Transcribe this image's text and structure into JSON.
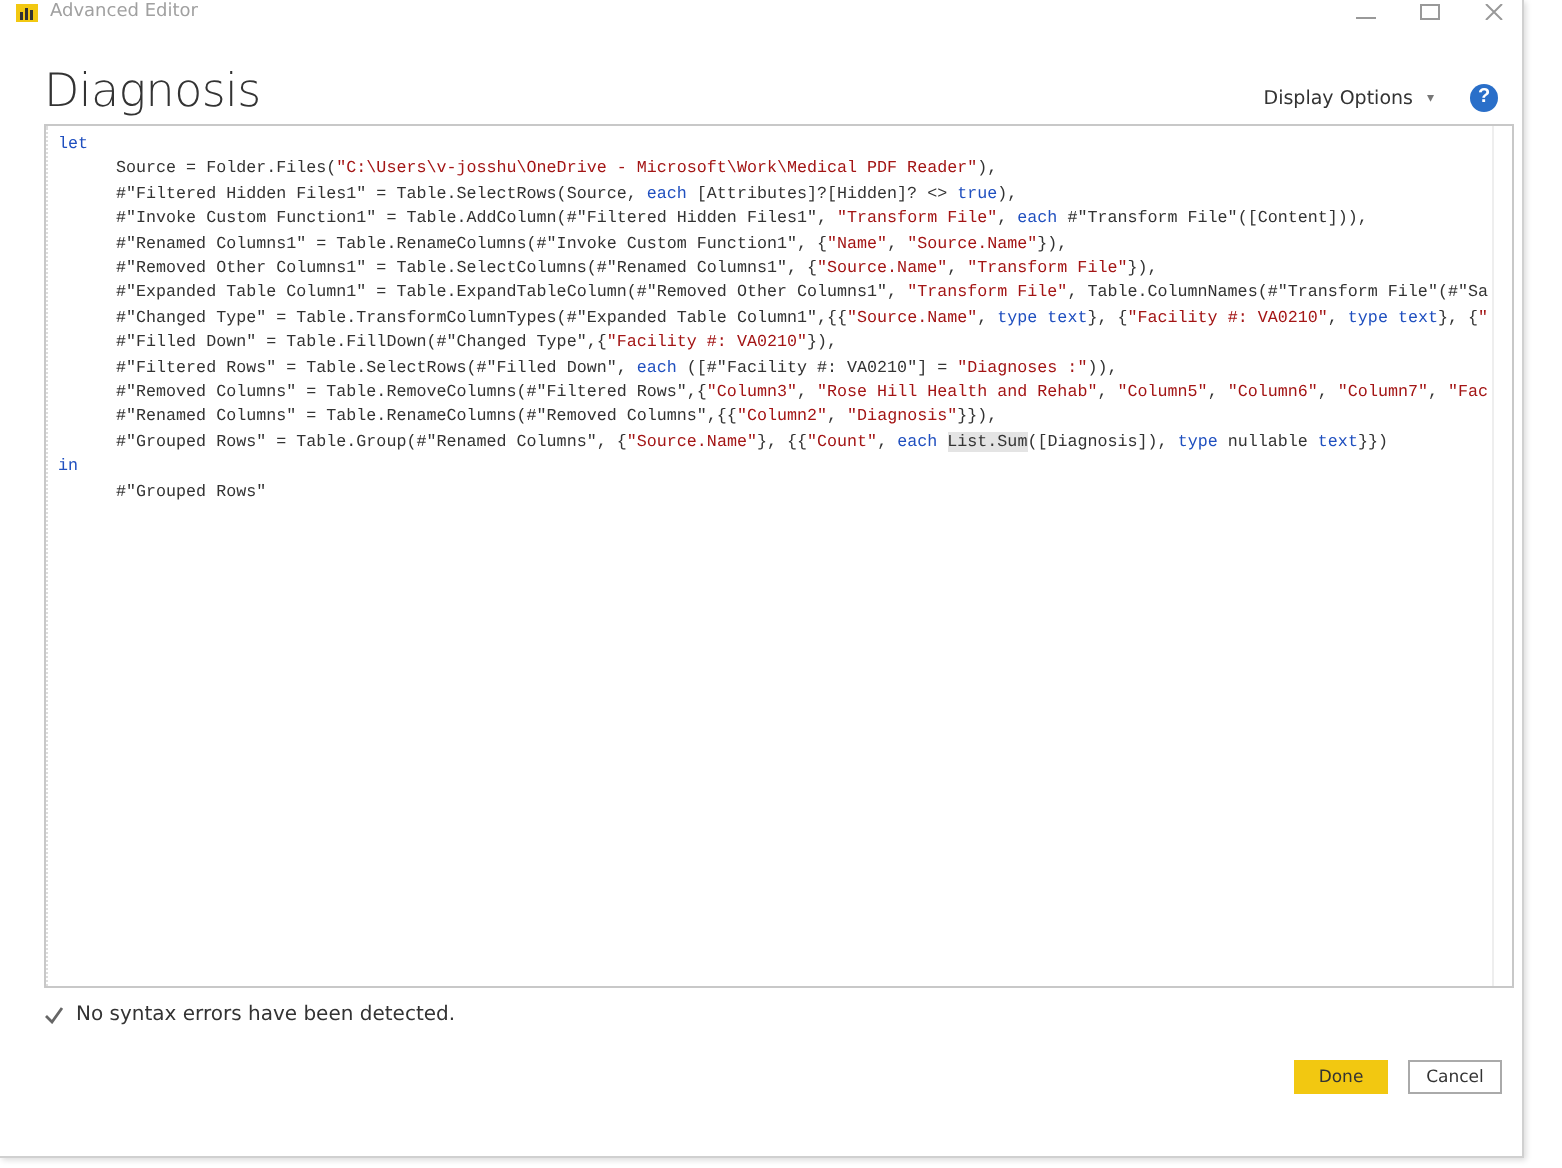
{
  "window": {
    "title": "Advanced Editor"
  },
  "heading": "Diagnosis",
  "display_options": {
    "label": "Display Options",
    "caret": "▾"
  },
  "help": {
    "label": "?"
  },
  "code": [
    {
      "keyword": "let",
      "children": [
        {
          "tokens": [
            {
              "kind": "plain",
              "text": "Source = Folder.Files("
            },
            {
              "kind": "string",
              "text": "\"C:\\Users\\v-josshu\\OneDrive - Microsoft\\Work\\Medical PDF Reader\""
            },
            {
              "kind": "plain",
              "text": "),"
            }
          ]
        },
        {
          "tokens": [
            {
              "kind": "plain",
              "text": "#\"Filtered Hidden Files1\" = Table.SelectRows(Source, "
            },
            {
              "kind": "keyword",
              "text": "each"
            },
            {
              "kind": "plain",
              "text": " [Attributes]?[Hidden]? <> "
            },
            {
              "kind": "keyword",
              "text": "true"
            },
            {
              "kind": "plain",
              "text": "),"
            }
          ]
        },
        {
          "tokens": [
            {
              "kind": "plain",
              "text": "#\"Invoke Custom Function1\" = Table.AddColumn(#\"Filtered Hidden Files1\", "
            },
            {
              "kind": "string",
              "text": "\"Transform File\""
            },
            {
              "kind": "plain",
              "text": ", "
            },
            {
              "kind": "keyword",
              "text": "each"
            },
            {
              "kind": "plain",
              "text": " #\"Transform File\"([Content])),"
            }
          ]
        },
        {
          "tokens": [
            {
              "kind": "plain",
              "text": "#\"Renamed Columns1\" = Table.RenameColumns(#\"Invoke Custom Function1\", {"
            },
            {
              "kind": "string",
              "text": "\"Name\""
            },
            {
              "kind": "plain",
              "text": ", "
            },
            {
              "kind": "string",
              "text": "\"Source.Name\""
            },
            {
              "kind": "plain",
              "text": "}),"
            }
          ]
        },
        {
          "tokens": [
            {
              "kind": "plain",
              "text": "#\"Removed Other Columns1\" = Table.SelectColumns(#\"Renamed Columns1\", {"
            },
            {
              "kind": "string",
              "text": "\"Source.Name\""
            },
            {
              "kind": "plain",
              "text": ", "
            },
            {
              "kind": "string",
              "text": "\"Transform File\""
            },
            {
              "kind": "plain",
              "text": "}),"
            }
          ]
        },
        {
          "tokens": [
            {
              "kind": "plain",
              "text": "#\"Expanded Table Column1\" = Table.ExpandTableColumn(#\"Removed Other Columns1\", "
            },
            {
              "kind": "string",
              "text": "\"Transform File\""
            },
            {
              "kind": "plain",
              "text": ", Table.ColumnNames(#\"Transform File\"(#\"Sa"
            }
          ]
        },
        {
          "tokens": [
            {
              "kind": "plain",
              "text": "#\"Changed Type\" = Table.TransformColumnTypes(#\"Expanded Table Column1\",{{"
            },
            {
              "kind": "string",
              "text": "\"Source.Name\""
            },
            {
              "kind": "plain",
              "text": ", "
            },
            {
              "kind": "keyword",
              "text": "type text"
            },
            {
              "kind": "plain",
              "text": "}, {"
            },
            {
              "kind": "string",
              "text": "\"Facility #: VA0210\""
            },
            {
              "kind": "plain",
              "text": ", "
            },
            {
              "kind": "keyword",
              "text": "type text"
            },
            {
              "kind": "plain",
              "text": "}, {"
            },
            {
              "kind": "string",
              "text": "\""
            }
          ]
        },
        {
          "tokens": [
            {
              "kind": "plain",
              "text": "#\"Filled Down\" = Table.FillDown(#\"Changed Type\",{"
            },
            {
              "kind": "string",
              "text": "\"Facility #: VA0210\""
            },
            {
              "kind": "plain",
              "text": "}),"
            }
          ]
        },
        {
          "tokens": [
            {
              "kind": "plain",
              "text": "#\"Filtered Rows\" = Table.SelectRows(#\"Filled Down\", "
            },
            {
              "kind": "keyword",
              "text": "each"
            },
            {
              "kind": "plain",
              "text": " ([#\"Facility #: VA0210\"] = "
            },
            {
              "kind": "string",
              "text": "\"Diagnoses :\""
            },
            {
              "kind": "plain",
              "text": ")),"
            }
          ]
        },
        {
          "tokens": [
            {
              "kind": "plain",
              "text": "#\"Removed Columns\" = Table.RemoveColumns(#\"Filtered Rows\",{"
            },
            {
              "kind": "string",
              "text": "\"Column3\""
            },
            {
              "kind": "plain",
              "text": ", "
            },
            {
              "kind": "string",
              "text": "\"Rose Hill Health and Rehab\""
            },
            {
              "kind": "plain",
              "text": ", "
            },
            {
              "kind": "string",
              "text": "\"Column5\""
            },
            {
              "kind": "plain",
              "text": ", "
            },
            {
              "kind": "string",
              "text": "\"Column6\""
            },
            {
              "kind": "plain",
              "text": ", "
            },
            {
              "kind": "string",
              "text": "\"Column7\""
            },
            {
              "kind": "plain",
              "text": ", "
            },
            {
              "kind": "string",
              "text": "\"Fac"
            }
          ]
        },
        {
          "tokens": [
            {
              "kind": "plain",
              "text": "#\"Renamed Columns\" = Table.RenameColumns(#\"Removed Columns\",{{"
            },
            {
              "kind": "string",
              "text": "\"Column2\""
            },
            {
              "kind": "plain",
              "text": ", "
            },
            {
              "kind": "string",
              "text": "\"Diagnosis\""
            },
            {
              "kind": "plain",
              "text": "}}),"
            }
          ]
        },
        {
          "tokens": [
            {
              "kind": "plain",
              "text": "#\"Grouped Rows\" = Table.Group(#\"Renamed Columns\", {"
            },
            {
              "kind": "string",
              "text": "\"Source.Name\""
            },
            {
              "kind": "plain",
              "text": "}, {{"
            },
            {
              "kind": "string",
              "text": "\"Count\""
            },
            {
              "kind": "plain",
              "text": ", "
            },
            {
              "kind": "keyword",
              "text": "each "
            },
            {
              "kind": "match",
              "text": "List.Sum"
            },
            {
              "kind": "plain",
              "text": "([Diagnosis]), "
            },
            {
              "kind": "keyword",
              "text": "type"
            },
            {
              "kind": "plain",
              "text": " nullable "
            },
            {
              "kind": "keyword",
              "text": "text"
            },
            {
              "kind": "plain",
              "text": "}})"
            }
          ]
        }
      ]
    },
    {
      "keyword": "in",
      "children": [
        {
          "tokens": [
            {
              "kind": "plain",
              "text": "#\"Grouped Rows\""
            }
          ]
        }
      ]
    }
  ],
  "status": {
    "ok": true,
    "message": "No syntax errors have been detected."
  },
  "buttons": [
    {
      "label": "Done",
      "kind": "primary"
    },
    {
      "label": "Cancel",
      "kind": "secondary"
    }
  ]
}
